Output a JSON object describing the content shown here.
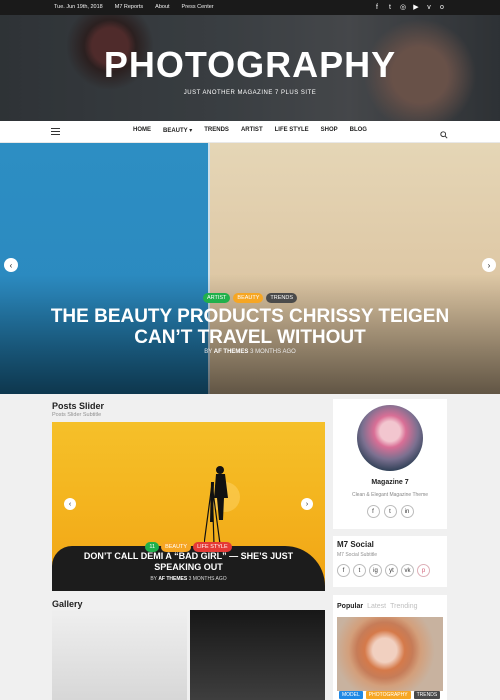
{
  "topbar": {
    "links": [
      "Tue. Jun 19th, 2018",
      "M7 Reports",
      "About",
      "Press Center"
    ],
    "social_icons": [
      "facebook-icon",
      "twitter-icon",
      "instagram-icon",
      "youtube-icon",
      "vk-icon",
      "odnoklassniki-icon"
    ]
  },
  "site": {
    "title": "PHOTOGRAPHY",
    "tagline": "JUST ANOTHER MAGAZINE 7 PLUS SITE"
  },
  "nav": {
    "items": [
      "HOME",
      "BEAUTY",
      "TRENDS",
      "ARTIST",
      "LIFE STYLE",
      "SHOP",
      "BLOG"
    ],
    "dropdown_icon": "▾"
  },
  "hero": {
    "categories": [
      {
        "label": "ARTIST",
        "color": "#20b04b"
      },
      {
        "label": "BEAUTY",
        "color": "#f6a623"
      },
      {
        "label": "TRENDS",
        "color": "#4a4a4a"
      }
    ],
    "title": "THE BEAUTY PRODUCTS CHRISSY TEIGEN CAN’T TRAVEL WITHOUT",
    "author_prefix": "BY",
    "author": "AF THEMES",
    "time": "3 MONTHS AGO",
    "prev": "‹",
    "next": "›"
  },
  "posts_slider": {
    "title": "Posts Slider",
    "subtitle": "Posts Slider Subtitle",
    "categories": [
      {
        "label": "11",
        "color": "#20b04b"
      },
      {
        "label": "BEAUTY",
        "color": "#f6a623"
      },
      {
        "label": "LIFE STYLE",
        "color": "#e53935"
      }
    ],
    "headline": "DON’T CALL DEMI A “BAD GIRL” — SHE’S JUST SPEAKING OUT",
    "author_prefix": "BY",
    "author": "AF THEMES",
    "time": "3 MONTHS AGO",
    "prev": "‹",
    "next": "›"
  },
  "gallery": {
    "title": "Gallery"
  },
  "author": {
    "name": "Magazine 7",
    "description": "Clean & Elegant Magazine Theme",
    "icons": [
      "f",
      "t",
      "in"
    ]
  },
  "m7_social": {
    "title": "M7 Social",
    "subtitle": "M7 Social Subtitle",
    "icons": [
      "f",
      "t",
      "ig",
      "yt",
      "vk",
      "p"
    ]
  },
  "tabs": {
    "items": [
      "Popular",
      "Latest",
      "Trending"
    ],
    "badges": [
      {
        "label": "MODEL",
        "color": "#1e88e5"
      },
      {
        "label": "PHOTOGRAPHY",
        "color": "#f6a623"
      },
      {
        "label": "TRENDS",
        "color": "#4a4a4a"
      }
    ]
  }
}
